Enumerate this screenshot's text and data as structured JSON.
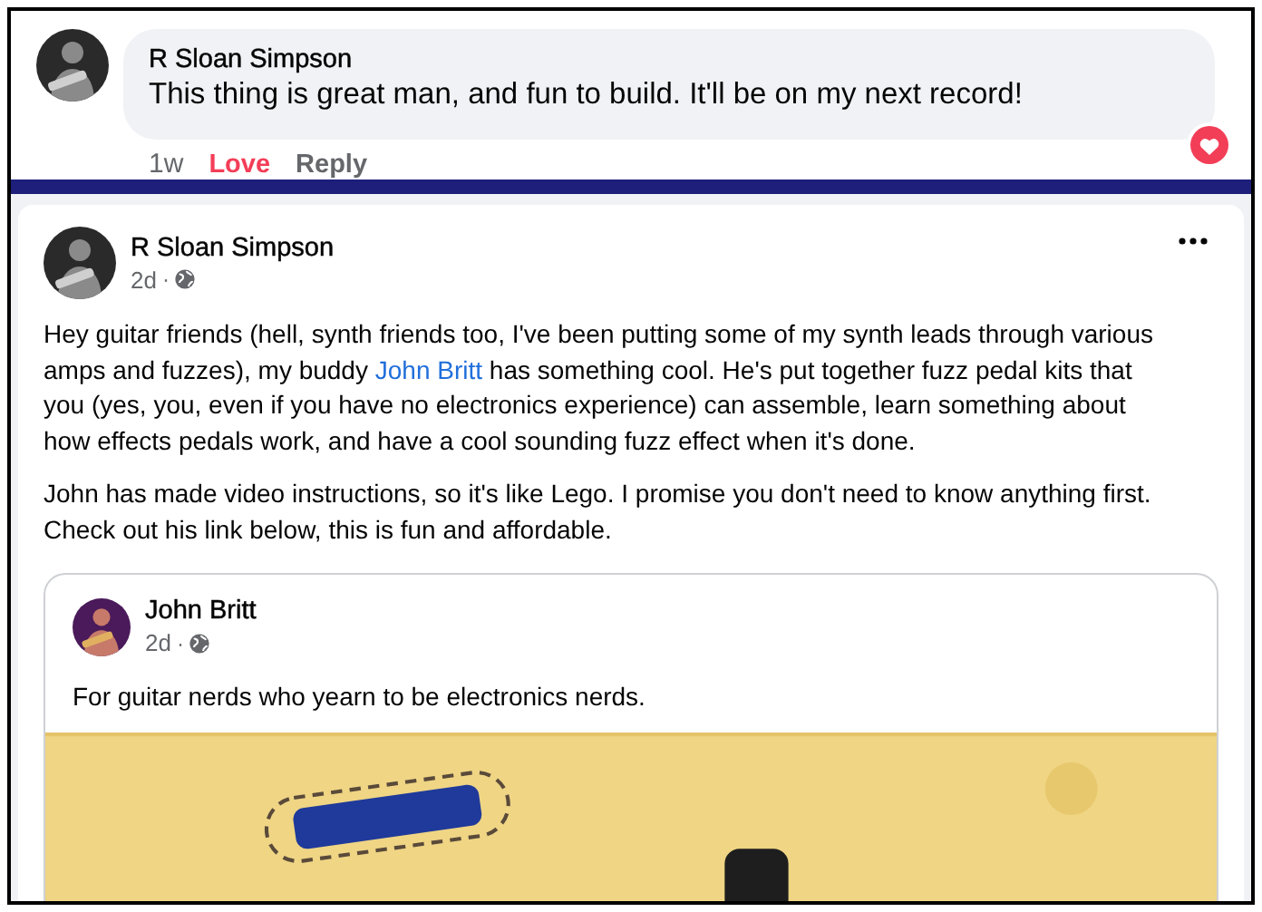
{
  "comment": {
    "author": "R Sloan Simpson",
    "text": "This thing is great man, and fun to build. It'll be on my next record!",
    "time": "1w",
    "love": {
      "label": "Love",
      "selected": true
    },
    "reply": "Reply"
  },
  "post": {
    "author": "R Sloan Simpson",
    "time": "2d",
    "separator": "·",
    "paragraphs": [
      [
        {
          "kind": "text",
          "text": "Hey guitar friends (hell, synth friends too, I've been putting some of my synth leads through various amps and fuzzes), my buddy "
        },
        {
          "kind": "link",
          "text": "John Britt"
        },
        {
          "kind": "text",
          "text": " has something cool. He's put together fuzz pedal kits that you (yes, you, even if you have no electronics experience) can assemble, learn something about how effects pedals work, and have a cool sounding fuzz effect when it's done."
        }
      ],
      [
        {
          "kind": "text",
          "text": "John has made video instructions, so it's like Lego. I promise you don't need to know anything first. Check out his link below, this is fun and affordable."
        }
      ]
    ],
    "shared": {
      "author": "John Britt",
      "time": "2d",
      "separator": "·",
      "text": "For guitar nerds who yearn to be electronics nerds."
    }
  }
}
